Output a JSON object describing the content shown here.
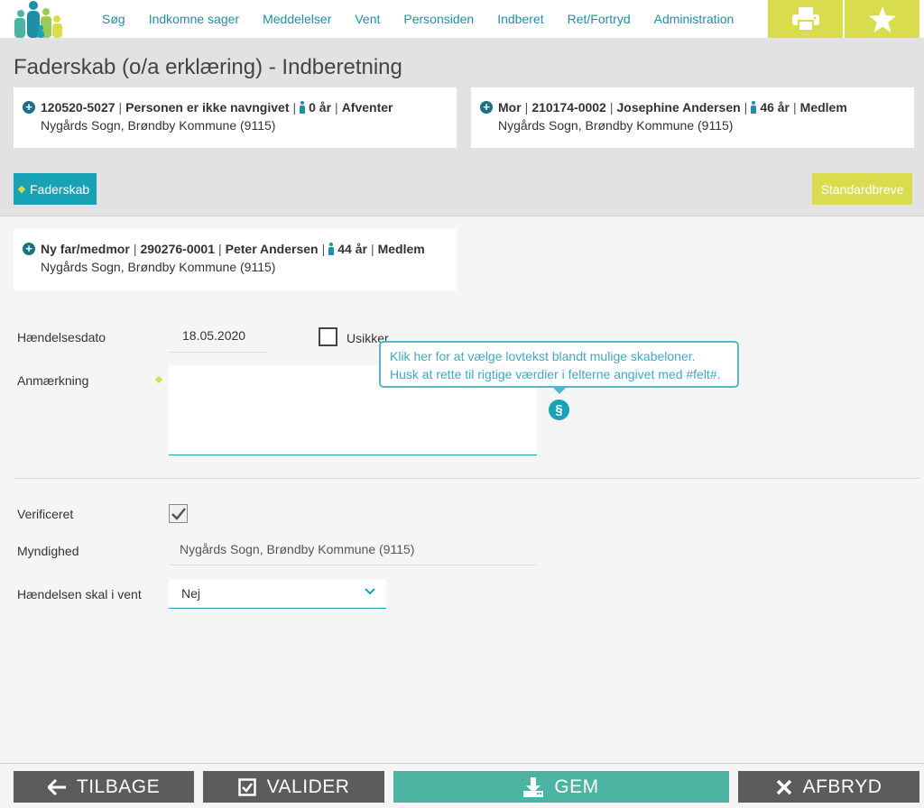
{
  "nav": {
    "items": [
      "Søg",
      "Indkomne sager",
      "Meddelelser",
      "Vent",
      "Personsiden",
      "Indberet",
      "Ret/Fortryd",
      "Administration"
    ]
  },
  "header": {
    "title": "Faderskab (o/a erklæring) - Indberetning",
    "child": {
      "cpr": "120520-5027",
      "name": "Personen er ikke navngivet",
      "age": "0 år",
      "status": "Afventer",
      "address": "Nygårds Sogn, Brøndby Kommune (9115)"
    },
    "mother": {
      "role": "Mor",
      "cpr": "210174-0002",
      "name": "Josephine Andersen",
      "age": "46 år",
      "status": "Medlem",
      "address": "Nygårds Sogn, Brøndby Kommune (9115)"
    },
    "tag_label": "Faderskab",
    "standard_letters_label": "Standardbreve"
  },
  "father": {
    "role": "Ny far/medmor",
    "cpr": "290276-0001",
    "name": "Peter Andersen",
    "age": "44 år",
    "status": "Medlem",
    "address": "Nygårds Sogn, Brøndby Kommune (9115)"
  },
  "form": {
    "event_date_label": "Hændelsesdato",
    "event_date_value": "18.05.2020",
    "uncertain_label": "Usikker",
    "remark_label": "Anmærkning",
    "remark_value": "",
    "tooltip_line1": "Klik her for at vælge lovtekst blandt mulige skabeloner.",
    "tooltip_line2": "Husk at rette til rigtige værdier i felterne angivet med #felt#.",
    "verified_label": "Verificeret",
    "verified_checked": true,
    "authority_label": "Myndighed",
    "authority_value": "Nygårds Sogn, Brøndby Kommune (9115)",
    "pending_label": "Hændelsen skal i vent",
    "pending_value": "Nej"
  },
  "actions": {
    "back": "TILBAGE",
    "validate": "VALIDER",
    "save": "GEM",
    "cancel": "AFBRYD"
  },
  "colors": {
    "accent_teal": "#17a3b5",
    "accent_yellow": "#d9dd4d",
    "save_green": "#4db3a3",
    "dark_button": "#5c5c5c"
  }
}
